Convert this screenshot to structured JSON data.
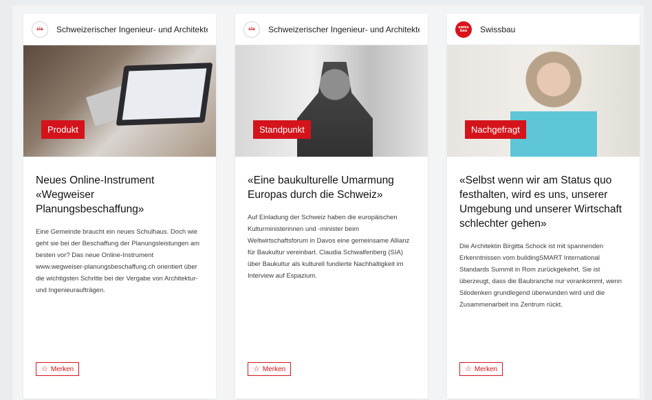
{
  "cards": [
    {
      "source": "Schweizerischer Ingenieur- und Architekten",
      "logo": "sia",
      "badge": "Produkt",
      "title": "Neues Online-Instrument «Wegweiser Planungsbeschaffung»",
      "text": "Eine Gemeinde braucht ein neues Schulhaus. Doch wie geht sie bei der Beschaffung der Planungsleistungen am besten vor? Das neue Online-Instrument www.wegweiser-planungsbeschaffung.ch orientiert über die wichtigsten Schritte bei der Vergabe von Architektur- und Ingenieuraufträgen.",
      "action": "Merken"
    },
    {
      "source": "Schweizerischer Ingenieur- und Architekten",
      "logo": "sia",
      "badge": "Standpunkt",
      "title": "«Eine baukulturelle Umarmung Europas durch die Schweiz»",
      "text": "Auf Einladung der Schweiz haben die europäischen Kulturministerinnen und -minister beim Weltwirtschaftsforum in Davos eine gemeinsame Allianz für Baukultur vereinbart. Claudia Schwalfenberg (SIA) über Baukultur als kulturell fundierte Nachhaltigkeit im Interview auf Espazium.",
      "action": "Merken"
    },
    {
      "source": "Swissbau",
      "logo": "swissbau",
      "badge": "Nachgefragt",
      "title": "«Selbst wenn wir am Status quo festhalten, wird es uns, unserer Umgebung und unserer Wirtschaft schlechter gehen»",
      "text": "Die Architektin Birgitta Schock ist mit spannenden Erkenntnissen vom buildingSMART International Standards Summit in Rom zurückgekehrt. Sie ist überzeugt, dass die Baubranche nur vorankommt, wenn Silodenken grundlegend überwunden wird und die Zusammenarbeit ins Zentrum rückt.",
      "action": "Merken"
    }
  ],
  "logos": {
    "sia": "sia",
    "swissbau": "swiss bau"
  },
  "colors": {
    "accent": "#d4131b",
    "background": "#f2f4f6",
    "card": "#ffffff"
  }
}
